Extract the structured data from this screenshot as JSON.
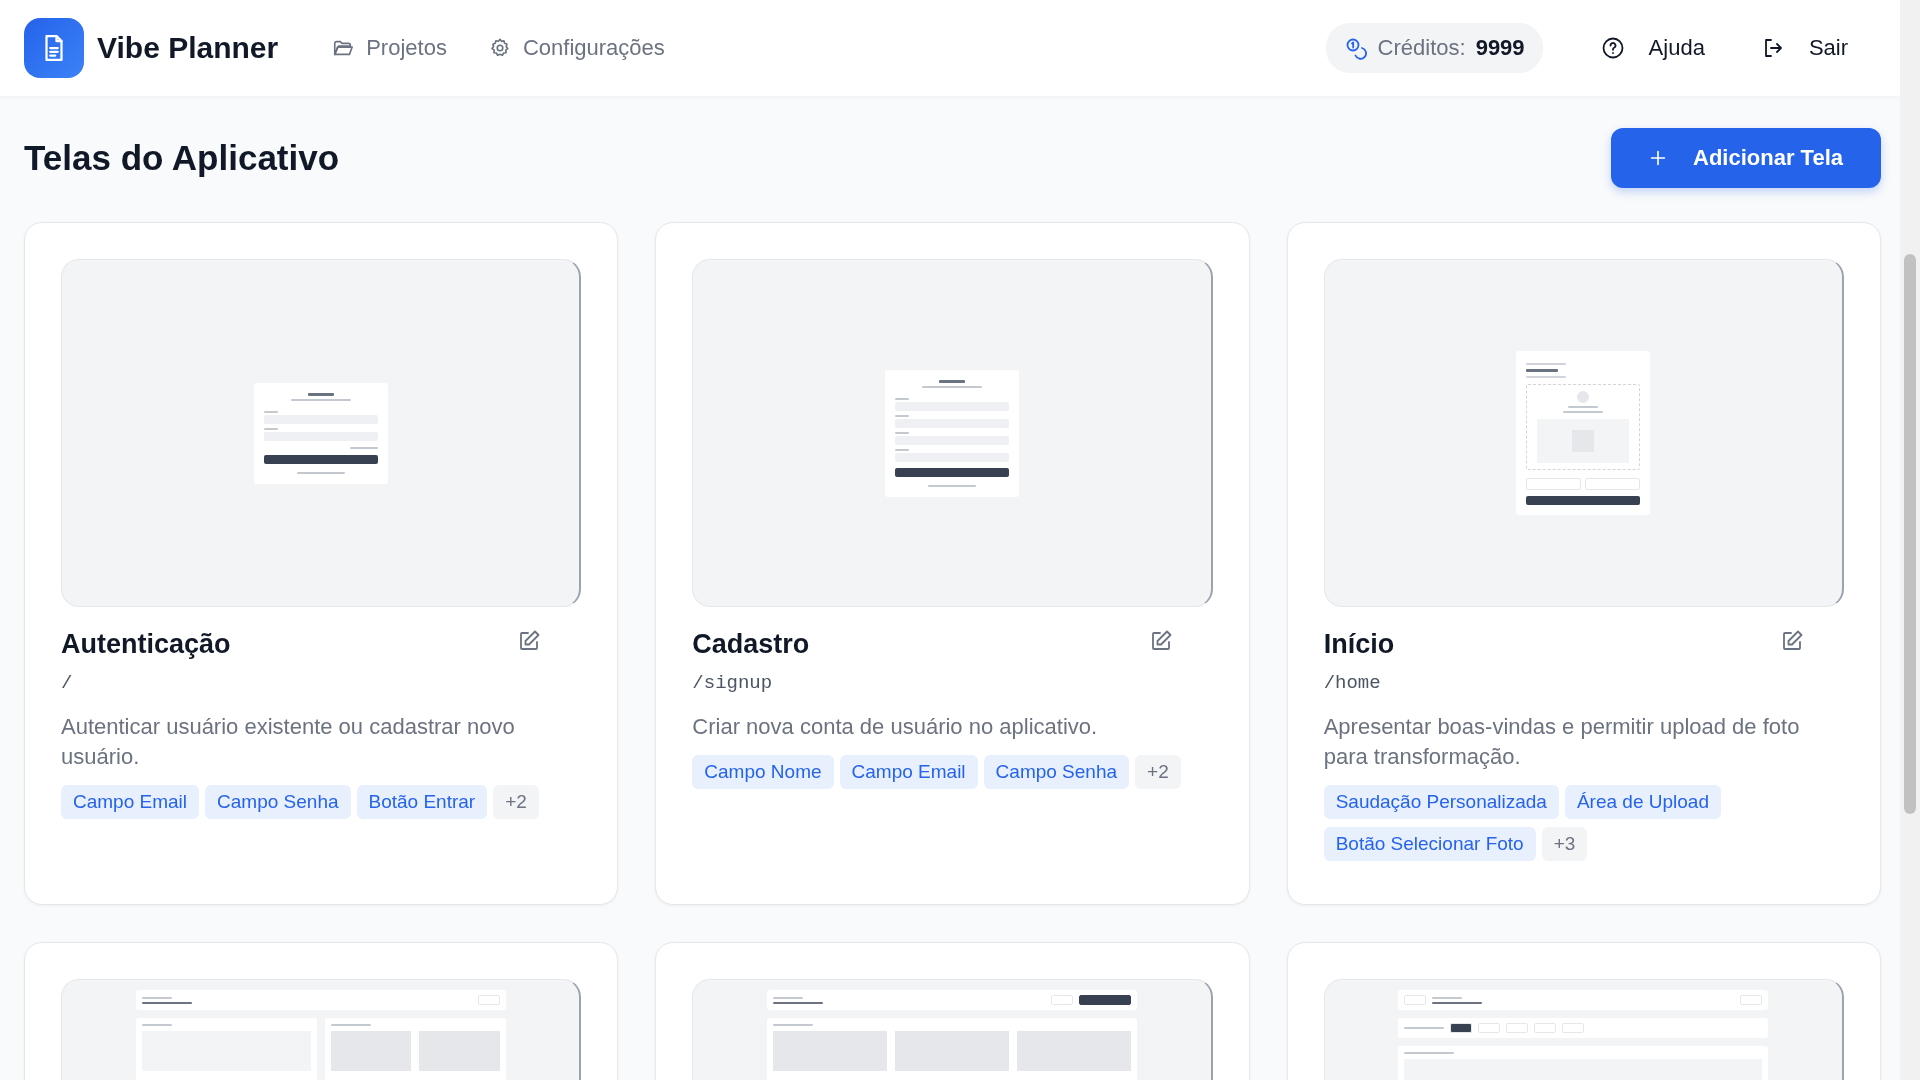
{
  "header": {
    "app_name": "Vibe Planner",
    "nav": [
      "Projetos",
      "Configurações"
    ],
    "credits": {
      "label": "Créditos:",
      "value": "9999"
    },
    "help": "Ajuda",
    "logout": "Sair"
  },
  "page": {
    "title": "Telas do Aplicativo",
    "add_button": "Adicionar Tela"
  },
  "screens": [
    {
      "name": "Autenticação",
      "route": "/",
      "description": "Autenticar usuário existente ou cadastrar novo usuário.",
      "tags": [
        "Campo Email",
        "Campo Senha",
        "Botão Entrar"
      ],
      "more": "+2",
      "preview": {
        "kind": "form"
      }
    },
    {
      "name": "Cadastro",
      "route": "/signup",
      "description": "Criar nova conta de usuário no aplicativo.",
      "tags": [
        "Campo Nome",
        "Campo Email",
        "Campo Senha"
      ],
      "more": "+2",
      "preview": {
        "kind": "form"
      }
    },
    {
      "name": "Início",
      "route": "/home",
      "description": "Apresentar boas-vindas e permitir upload de foto para transformação.",
      "tags": [
        "Saudação Personalizada",
        "Área de Upload",
        "Botão Selecionar Foto"
      ],
      "more": "+3",
      "preview": {
        "kind": "form"
      }
    },
    {
      "preview": {
        "kind": "page"
      }
    },
    {
      "preview": {
        "kind": "page"
      }
    },
    {
      "preview": {
        "kind": "page"
      }
    }
  ]
}
